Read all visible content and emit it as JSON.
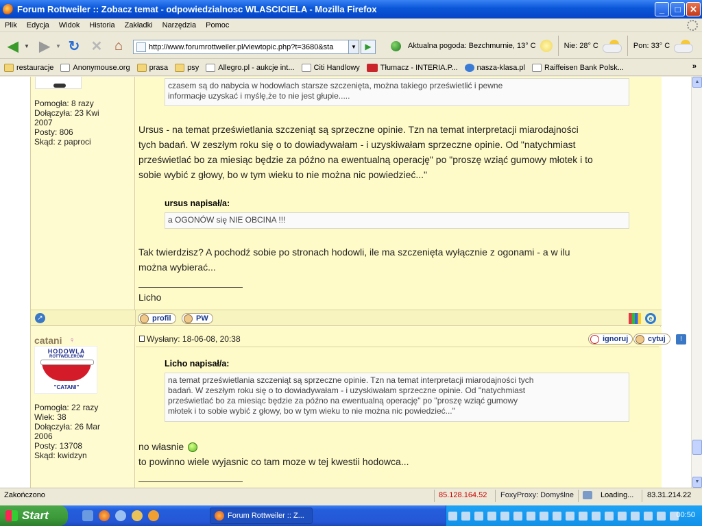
{
  "window": {
    "title": "Forum Rottweiler :: Zobacz temat - odpowiedzialnosc WLASCICIELA - Mozilla Firefox"
  },
  "menu": [
    "Plik",
    "Edycja",
    "Widok",
    "Historia",
    "Zakładki",
    "Narzędzia",
    "Pomoc"
  ],
  "url": "http://www.forumrottweiler.pl/viewtopic.php?t=3680&sta",
  "weather": {
    "current": "Aktualna pogoda: Bezchmurnie, 13° C",
    "day1": "Nie: 28° C",
    "day2": "Pon: 33° C"
  },
  "bookmarks": [
    "restauracje",
    "Anonymouse.org",
    "prasa",
    "psy",
    "Allegro.pl - aukcje int...",
    "Citi Handlowy",
    "Tłumacz - INTERIA.P...",
    "nasza-klasa.pl",
    "Raiffeisen Bank Polsk..."
  ],
  "post1": {
    "stats": {
      "line1": "Pomogła: 8 razy",
      "line2": "Dołączyła: 23 Kwi",
      "line3": "2007",
      "line4": "Posty: 806",
      "line5": "Skąd: z paproci"
    },
    "quote1": {
      "line1": "czasem są do nabycia w hodowlach starsze szczenięta, można takiego prześwietlić i pewne",
      "line2": "informacje uzyskać i myślę,że to nie jest głupie....."
    },
    "para1": {
      "line1": "Ursus - na temat prześwietlania szczeniąt są sprzeczne opinie. Tzn na temat interpretacji miarodajności",
      "line2": "tych badań. W zeszłym roku się o to dowiadywałam - i uzyskiwałam sprzeczne opinie. Od \"natychmiast",
      "line3": "prześwietlać bo za miesiąc będzie za późno na ewentualną operację\" po \"proszę wziąć gumowy młotek i to",
      "line4": "sobie wybić z głowy, bo w tym wieku to nie można nic powiedzieć...\""
    },
    "quote2_head": "ursus napisał/a:",
    "quote2": "a OGONÓW się NIE OBCINA !!!",
    "para2": {
      "line1": "Tak twierdzisz? A pochodź sobie po stronach hodowli, ile ma szczenięta wyłącznie z ogonami - a w ilu",
      "line2": "można wybierać..."
    },
    "signature": "Licho",
    "btn_profile": "profil",
    "btn_pm": "PW"
  },
  "post2": {
    "username": "catani",
    "logo": {
      "top": "HODOWLA",
      "sub": "ROTTWEILERÓW",
      "bottom": "\"CATANI\""
    },
    "stats": {
      "line1": "Pomogła: 22 razy",
      "line2": "Wiek: 38",
      "line3": "Dołączyła: 26 Mar",
      "line4": "2006",
      "line5": "Posty: 13708",
      "line6": "Skąd: kwidzyn"
    },
    "posted": "Wysłany: 18-06-08, 20:38",
    "btn_ignore": "ignoruj",
    "btn_quote": "cytuj",
    "quote_head": "Licho napisał/a:",
    "quote": {
      "line1": "na temat prześwietlania szczeniąt są sprzeczne opinie. Tzn na temat interpretacji miarodajności tych",
      "line2": "badań. W zeszłym roku się o to dowiadywałam - i uzyskiwałam sprzeczne opinie. Od \"natychmiast",
      "line3": "prześwietlać bo za miesiąc będzie za późno na ewentualną operację\" po \"proszę wziąć gumowy",
      "line4": "młotek i to sobie wybić z głowy, bo w tym wieku to nie można nic powiedzieć...\""
    },
    "text1": "no własnie",
    "text2": "to powinno wiele wyjasnic co tam moze w tej kwestii hodowca..."
  },
  "status": {
    "text": "Zakończono",
    "ip_red": "85.128.164.52",
    "proxy": "FoxyProxy: Domyślne",
    "loading": "Loading...",
    "ip": "83.31.214.22"
  },
  "taskbar": {
    "start": "Start",
    "item": "Forum Rottweiler :: Z...",
    "clock": "00:50"
  }
}
